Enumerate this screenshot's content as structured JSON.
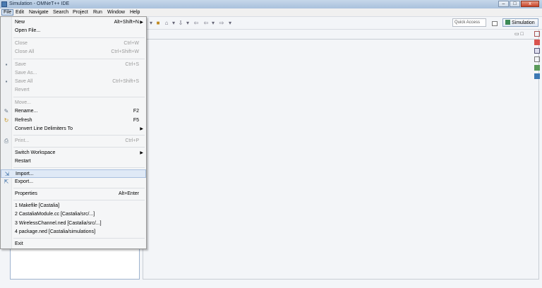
{
  "window": {
    "title": "Simulation - OMNeT++ IDE",
    "minimize": "–",
    "maximize": "□",
    "close": "x"
  },
  "menubar": {
    "items": [
      "File",
      "Edit",
      "Navigate",
      "Search",
      "Project",
      "Run",
      "Window",
      "Help"
    ]
  },
  "toolbar": {
    "quick_access": "Quick Access",
    "perspective": "Simulation"
  },
  "file_menu": {
    "new": {
      "label": "New",
      "accel": "Alt+Shift+N"
    },
    "open_file": {
      "label": "Open File..."
    },
    "close": {
      "label": "Close",
      "accel": "Ctrl+W"
    },
    "close_all": {
      "label": "Close All",
      "accel": "Ctrl+Shift+W"
    },
    "save": {
      "label": "Save",
      "accel": "Ctrl+S"
    },
    "save_as": {
      "label": "Save As..."
    },
    "save_all": {
      "label": "Save All",
      "accel": "Ctrl+Shift+S"
    },
    "revert": {
      "label": "Revert"
    },
    "move": {
      "label": "Move..."
    },
    "rename": {
      "label": "Rename...",
      "accel": "F2"
    },
    "refresh": {
      "label": "Refresh",
      "accel": "F5"
    },
    "convert": {
      "label": "Convert Line Delimiters To"
    },
    "print": {
      "label": "Print...",
      "accel": "Ctrl+P"
    },
    "switch_workspace": {
      "label": "Switch Workspace"
    },
    "restart": {
      "label": "Restart"
    },
    "import": {
      "label": "Import..."
    },
    "export": {
      "label": "Export..."
    },
    "properties": {
      "label": "Properties",
      "accel": "Alt+Enter"
    },
    "recent": [
      "1 Makefile  [Castalia]",
      "2 CastaliaModule.cc  [Castalia/src/...]",
      "3 WirelessChannel.ned  [Castalia/src/...]",
      "4 package.ned  [Castalia/simulations]"
    ],
    "exit": {
      "label": "Exit"
    }
  }
}
